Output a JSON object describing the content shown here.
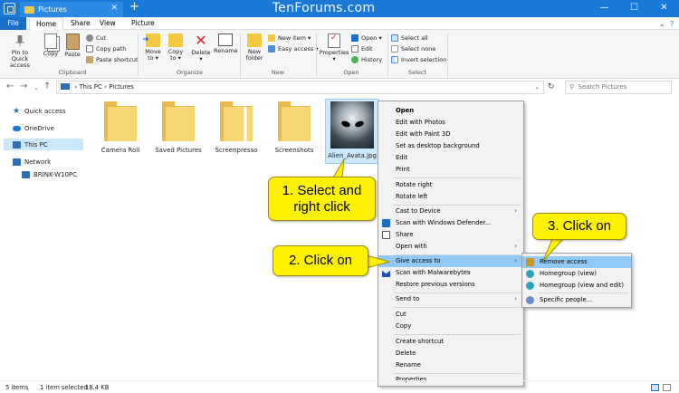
{
  "window": {
    "tab_title": "Pictures",
    "watermark": "TenForums.com",
    "controls": {
      "minimize": "—",
      "maximize": "☐",
      "close": "✕"
    },
    "new_tab": "+",
    "tab_close": "✕"
  },
  "ribbon_tabs": {
    "file": "File",
    "home": "Home",
    "share": "Share",
    "view": "View",
    "picture_tools": "Picture Tools"
  },
  "ribbon": {
    "clipboard": {
      "pin": "Pin to Quick access",
      "copy": "Copy",
      "paste": "Paste",
      "cut": "Cut",
      "copy_path": "Copy path",
      "paste_shortcut": "Paste shortcut",
      "label": "Clipboard"
    },
    "organize": {
      "move_to": "Move to",
      "copy_to": "Copy to",
      "delete": "Delete",
      "rename": "Rename",
      "label": "Organize"
    },
    "new": {
      "new_folder": "New folder",
      "new_item": "New item",
      "easy_access": "Easy access",
      "label": "New"
    },
    "open": {
      "properties": "Properties",
      "open": "Open",
      "edit": "Edit",
      "history": "History",
      "label": "Open"
    },
    "select": {
      "select_all": "Select all",
      "select_none": "Select none",
      "invert": "Invert selection",
      "label": "Select"
    }
  },
  "address": {
    "this_pc": "This PC",
    "pictures": "Pictures",
    "sep": "›",
    "search_placeholder": "Search Pictures"
  },
  "nav_pane": [
    {
      "label": "Quick access"
    },
    {
      "label": "OneDrive"
    },
    {
      "label": "This PC"
    },
    {
      "label": "Network"
    },
    {
      "label": "BRINK-W10PC"
    }
  ],
  "files": [
    {
      "name": "Camera Roll"
    },
    {
      "name": "Saved Pictures"
    },
    {
      "name": "Screenpresso"
    },
    {
      "name": "Screenshots"
    },
    {
      "name": "Alien_Avata.jpg"
    }
  ],
  "context_menu": [
    {
      "label": "Open"
    },
    {
      "label": "Edit with Photos"
    },
    {
      "label": "Edit with Paint 3D"
    },
    {
      "label": "Set as desktop background"
    },
    {
      "label": "Edit"
    },
    {
      "label": "Print"
    },
    {
      "label": "Rotate right"
    },
    {
      "label": "Rotate left"
    },
    {
      "label": "Cast to Device"
    },
    {
      "label": "Scan with Windows Defender..."
    },
    {
      "label": "Share"
    },
    {
      "label": "Open with"
    },
    {
      "label": "Give access to"
    },
    {
      "label": "Scan with Malwarebytes"
    },
    {
      "label": "Restore previous versions"
    },
    {
      "label": "Send to"
    },
    {
      "label": "Cut"
    },
    {
      "label": "Copy"
    },
    {
      "label": "Create shortcut"
    },
    {
      "label": "Delete"
    },
    {
      "label": "Rename"
    },
    {
      "label": "Properties"
    }
  ],
  "submenu": [
    {
      "label": "Remove access"
    },
    {
      "label": "Homegroup (view)"
    },
    {
      "label": "Homegroup (view and edit)"
    },
    {
      "label": "Specific people..."
    }
  ],
  "callouts": {
    "step1": "1. Select and right  click",
    "step2": "2. Click on",
    "step3": "3. Click on"
  },
  "status": {
    "items": "5 items",
    "selected": "1 item selected",
    "size": "18.4 KB"
  },
  "colors": {
    "titlebar": "#1a78d6",
    "highlight": "#91c9f7",
    "selection": "#cce8ff",
    "callout": "#fff200"
  }
}
